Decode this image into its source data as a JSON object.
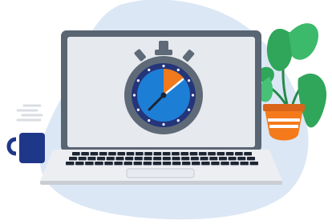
{
  "illustration": {
    "subject": "laptop-with-stopwatch",
    "icons": [
      "stopwatch-icon",
      "laptop-icon",
      "coffee-mug-icon",
      "potted-plant-icon"
    ]
  },
  "colors": {
    "blob": "#dbe7f4",
    "laptop_frame": "#5a6573",
    "screen": "#e6e9ed",
    "laptop_base": "#eceef2",
    "keyboard_key": "#1d2533",
    "stopwatch_body": "#5f6a78",
    "stopwatch_face": "#1d7ed6",
    "stopwatch_ring": "#24357a",
    "stopwatch_elapsed": "#f07a1c",
    "mug": "#1f3788",
    "steam": "#d9dde3",
    "leaf": "#2fa65a",
    "pot": "#f47a1c"
  },
  "stopwatch": {
    "elapsed_fraction": 0.14
  }
}
